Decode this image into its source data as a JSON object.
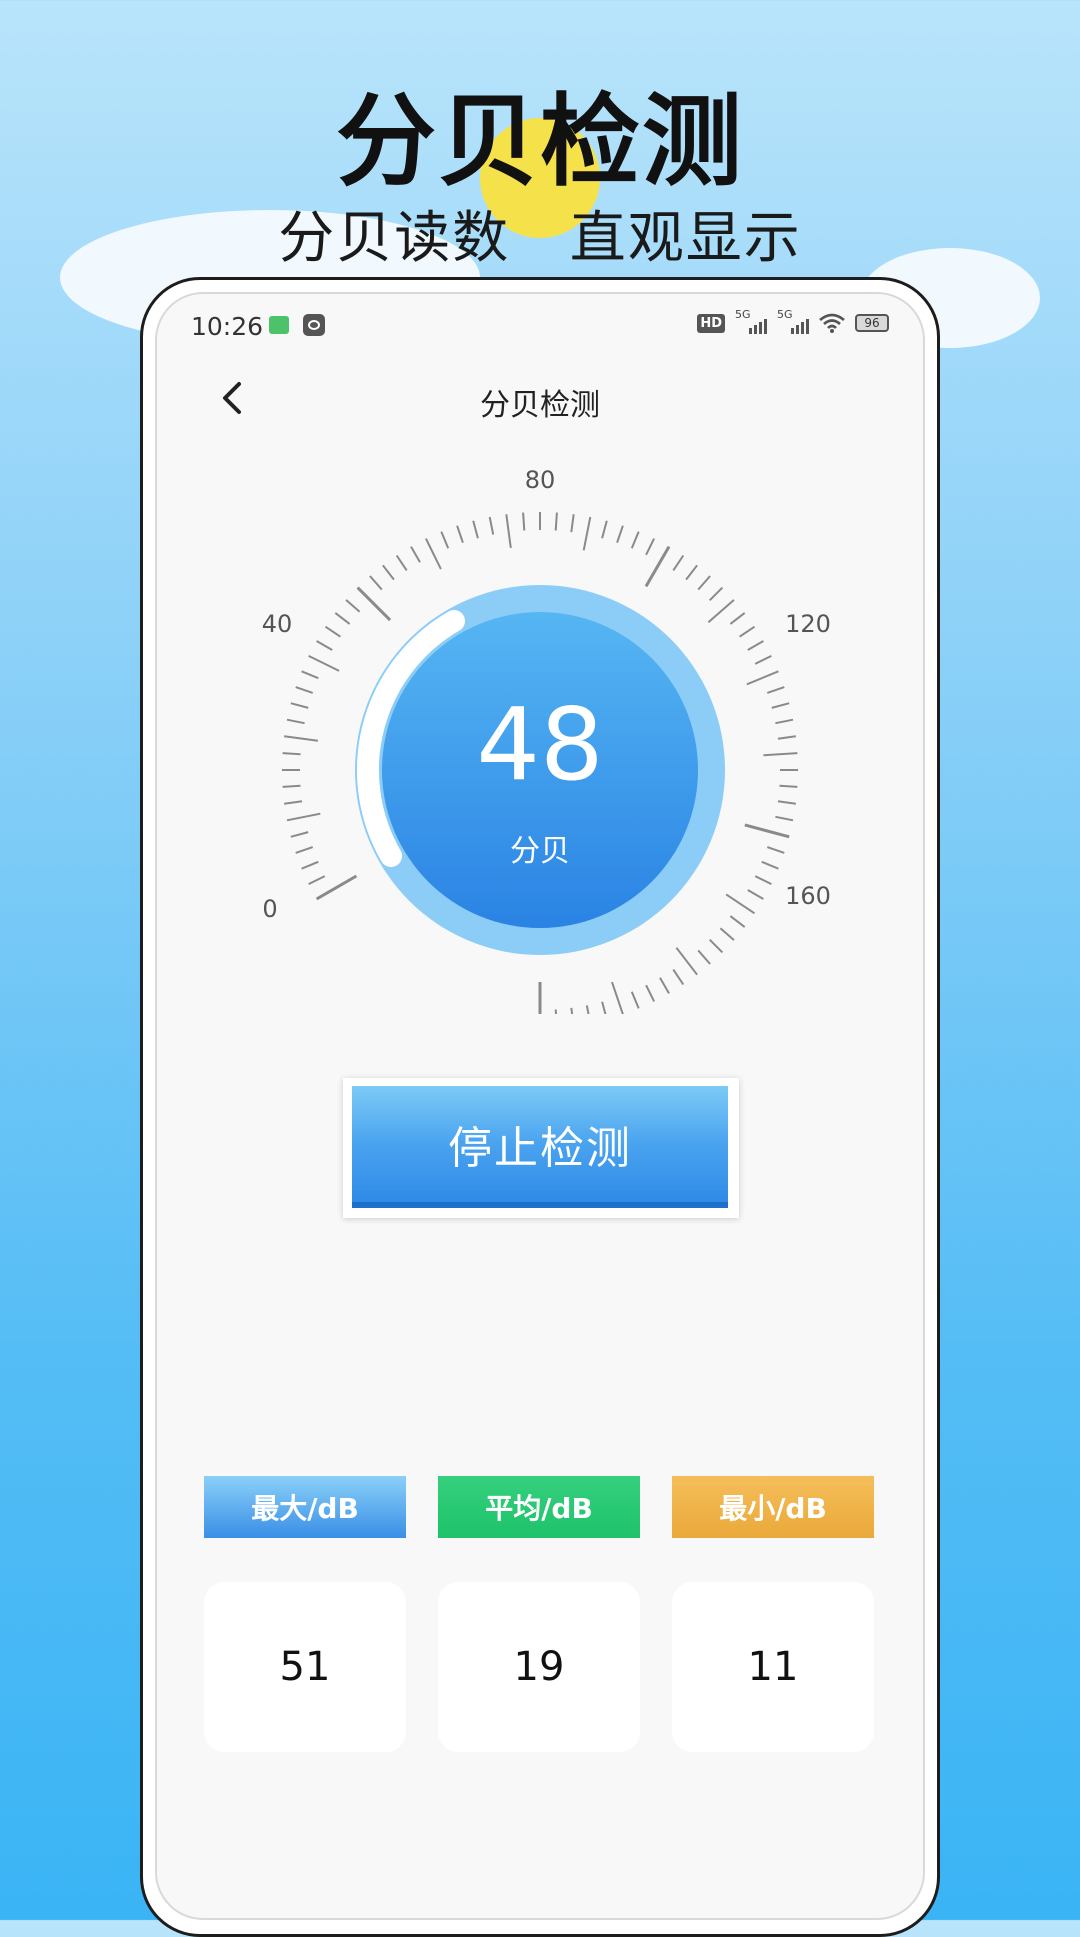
{
  "promo": {
    "title": "分贝检测",
    "subtitle": "分贝读数   直观显示"
  },
  "status_bar": {
    "time": "10:26",
    "network1": "5G",
    "network2": "5G",
    "battery": "96"
  },
  "nav": {
    "title": "分贝检测",
    "back_icon": "chevron-left-icon"
  },
  "gauge": {
    "value": "48",
    "unit": "分贝",
    "scale_labels": [
      "0",
      "40",
      "80",
      "120",
      "160"
    ],
    "scale_min": 0,
    "scale_max": 160,
    "current_level": 48,
    "colors": {
      "dial_inner": "#3a97ea",
      "dial_outer": "#8ccdf8",
      "progress": "#ffffff",
      "ticks": "#8a8a8a"
    }
  },
  "stop_button": {
    "label": "停止检测"
  },
  "stats": {
    "max": {
      "label": "最大/dB",
      "value": "51",
      "color": "#3a8fe6"
    },
    "avg": {
      "label": "平均/dB",
      "value": "19",
      "color": "#1dc26a"
    },
    "min": {
      "label": "最小/dB",
      "value": "11",
      "color": "#eaa93a"
    }
  }
}
